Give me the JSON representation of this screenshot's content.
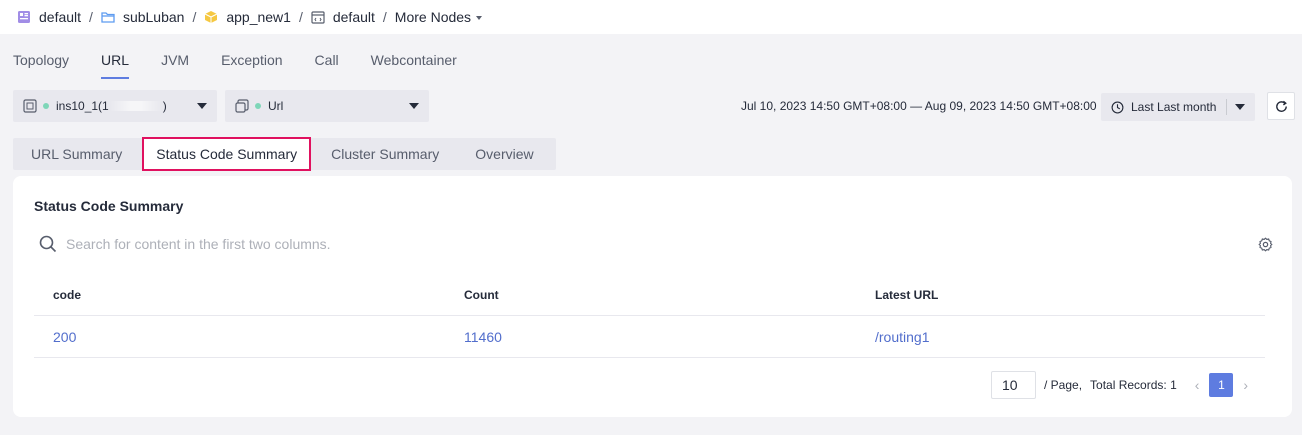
{
  "breadcrumb": [
    {
      "label": "default",
      "icon": "project-icon"
    },
    {
      "label": "subLuban",
      "icon": "folder-icon"
    },
    {
      "label": "app_new1",
      "icon": "cube-icon"
    },
    {
      "label": "default",
      "icon": "environment-icon"
    }
  ],
  "breadcrumb_more": "More Nodes",
  "breadcrumb_sep": "/",
  "main_tabs": [
    "Topology",
    "URL",
    "JVM",
    "Exception",
    "Call",
    "Webcontainer"
  ],
  "active_main_tab": "URL",
  "instance_select": {
    "prefix": "ins10_1(1",
    "suffix": ")"
  },
  "type_select": {
    "value": "Url"
  },
  "date_range": "Jul 10, 2023 14:50 GMT+08:00 — Aug 09, 2023 14:50 GMT+08:00",
  "time_select": {
    "value": "Last Last month"
  },
  "sub_tabs": [
    "URL Summary",
    "Status Code Summary",
    "Cluster Summary",
    "Overview"
  ],
  "active_sub_tab": "Status Code Summary",
  "card": {
    "title": "Status Code Summary",
    "search_placeholder": "Search for content in the first two columns."
  },
  "table": {
    "columns": [
      "code",
      "Count",
      "Latest URL"
    ],
    "rows": [
      [
        "200",
        "11460",
        "/routing1"
      ]
    ]
  },
  "pagination": {
    "page_size": "10",
    "per_page_label": "/ Page,",
    "total_label": "Total Records: 1",
    "current_page": "1"
  },
  "colors": {
    "accent": "#5e7ce0",
    "link": "#526ecc",
    "highlight_border": "#e0115f",
    "status_dot": "#7ed6b8"
  }
}
